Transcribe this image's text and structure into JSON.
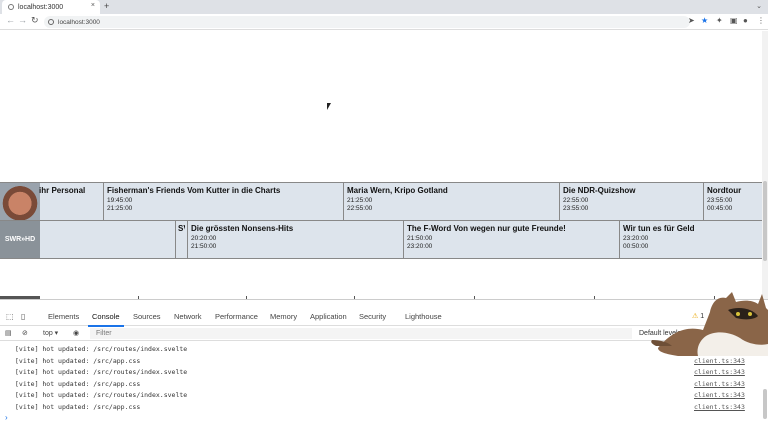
{
  "browser": {
    "tab_title": "localhost:3000",
    "tab_close": "×",
    "new_tab": "+",
    "url": "localhost:3000"
  },
  "epg": {
    "rows": [
      {
        "channel_icon": "face-logo",
        "cells": [
          {
            "title": "ihr Personal",
            "start": "",
            "end": ""
          },
          {
            "title": "Fisherman's Friends Vom Kutter in die Charts",
            "start": "19:45:00",
            "end": "21:25:00"
          },
          {
            "title": "Maria Wern, Kripo Gotland",
            "start": "21:25:00",
            "end": "22:55:00"
          },
          {
            "title": "Die NDR-Quizshow",
            "start": "22:55:00",
            "end": "23:55:00"
          },
          {
            "title": "Nordtour",
            "start": "23:55:00",
            "end": "00:45:00"
          }
        ]
      },
      {
        "channel_label": "SWR»HD",
        "cells": [
          {
            "title": "",
            "start": "",
            "end": ""
          },
          {
            "title": "SV",
            "start": "",
            "end": ""
          },
          {
            "title": "Die grössten Nonsens-Hits",
            "start": "20:20:00",
            "end": "21:50:00"
          },
          {
            "title": "The F-Word Von wegen nur gute Freunde!",
            "start": "21:50:00",
            "end": "23:20:00"
          },
          {
            "title": "Wir tun es für Geld",
            "start": "23:20:00",
            "end": "00:50:00"
          }
        ]
      }
    ]
  },
  "devtools": {
    "tabs": [
      "Elements",
      "Console",
      "Sources",
      "Network",
      "Performance",
      "Memory",
      "Application",
      "Security",
      "Lighthouse"
    ],
    "active_tab": "Console",
    "warning_count": "1",
    "context": "top ▾",
    "filter_placeholder": "Filter",
    "levels": "Default levels ▾",
    "logs": [
      {
        "msg": "[vite] hot updated: /src/routes/index.svelte",
        "src": "client.ts:343"
      },
      {
        "msg": "[vite] hot updated: /src/app.css",
        "src": "client.ts:343"
      },
      {
        "msg": "[vite] hot updated: /src/routes/index.svelte",
        "src": "client.ts:343"
      },
      {
        "msg": "[vite] hot updated: /src/app.css",
        "src": "client.ts:343"
      },
      {
        "msg": "[vite] hot updated: /src/routes/index.svelte",
        "src": "client.ts:343"
      },
      {
        "msg": "[vite] hot updated: /src/app.css",
        "src": "client.ts:343"
      }
    ],
    "prompt": "›"
  },
  "colors": {
    "accent": "#1a73e8",
    "epg_row_bg": "#dde4ec"
  }
}
